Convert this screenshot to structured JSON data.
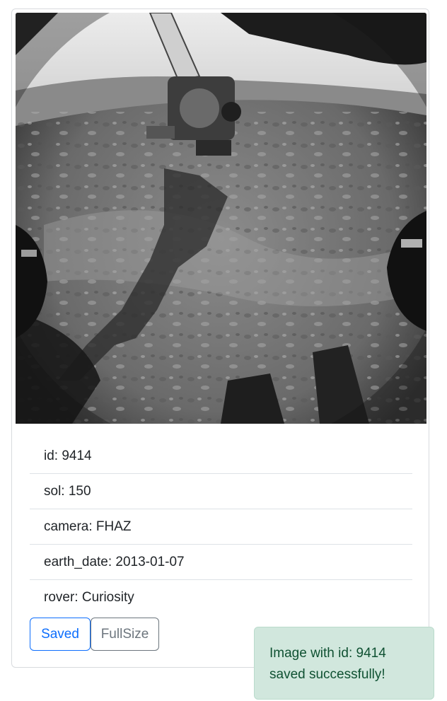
{
  "photo": {
    "alt_icon": "mars-rover-image"
  },
  "details": [
    {
      "label": "id: 9414"
    },
    {
      "label": "sol: 150"
    },
    {
      "label": "camera: FHAZ"
    },
    {
      "label": "earth_date: 2013-01-07"
    },
    {
      "label": "rover: Curiosity"
    }
  ],
  "actions": {
    "saved_label": "Saved",
    "fullsize_label": "FullSize"
  },
  "toast": {
    "message": "Image with id: 9414 saved successfully!"
  },
  "colors": {
    "primary": "#0d6efd",
    "secondary": "#6c757d",
    "success_bg": "#d1e7dd",
    "success_text": "#0f5132"
  }
}
